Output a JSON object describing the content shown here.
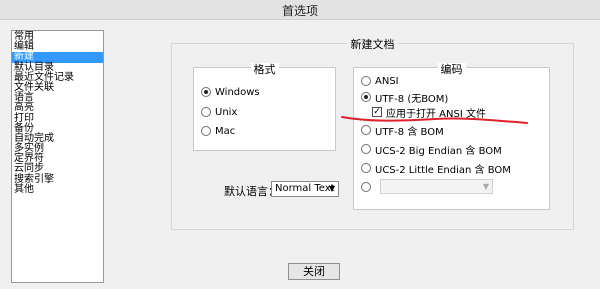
{
  "window": {
    "title": "首选项"
  },
  "sidebar": {
    "items": [
      {
        "label": "常用",
        "selected": false
      },
      {
        "label": "编辑",
        "selected": false
      },
      {
        "label": "新建",
        "selected": true
      },
      {
        "label": "默认目录",
        "selected": false
      },
      {
        "label": "最近文件记录",
        "selected": false
      },
      {
        "label": "文件关联",
        "selected": false
      },
      {
        "label": "语言",
        "selected": false
      },
      {
        "label": "高亮",
        "selected": false
      },
      {
        "label": "打印",
        "selected": false
      },
      {
        "label": "备份",
        "selected": false
      },
      {
        "label": "自动完成",
        "selected": false
      },
      {
        "label": "多实例",
        "selected": false
      },
      {
        "label": "定界符",
        "selected": false
      },
      {
        "label": "云同步",
        "selected": false
      },
      {
        "label": "搜索引擎",
        "selected": false
      },
      {
        "label": "其他",
        "selected": false
      }
    ]
  },
  "new_document": {
    "title": "新建文档",
    "format": {
      "title": "格式",
      "options": [
        {
          "label": "Windows",
          "checked": true
        },
        {
          "label": "Unix",
          "checked": false
        },
        {
          "label": "Mac",
          "checked": false
        }
      ]
    },
    "encoding": {
      "title": "编码",
      "options": [
        {
          "label": "ANSI",
          "checked": false
        },
        {
          "label": "UTF-8 (无BOM)",
          "checked": true
        },
        {
          "label": "UTF-8 含 BOM",
          "checked": false
        },
        {
          "label": "UCS-2 Big Endian 含 BOM",
          "checked": false
        },
        {
          "label": "UCS-2 Little Endian 含 BOM",
          "checked": false
        },
        {
          "label": "",
          "checked": false
        }
      ],
      "apply_ansi_checkbox": {
        "label": "应用于打开 ANSI 文件",
        "checked": true
      },
      "other_encoding_select": {
        "value": ""
      }
    },
    "default_language": {
      "label": "默认语言：",
      "value": "Normal Text"
    }
  },
  "footer": {
    "close_label": "关闭"
  },
  "colors": {
    "selection": "#3399ff",
    "annotation": "#e0202a"
  }
}
